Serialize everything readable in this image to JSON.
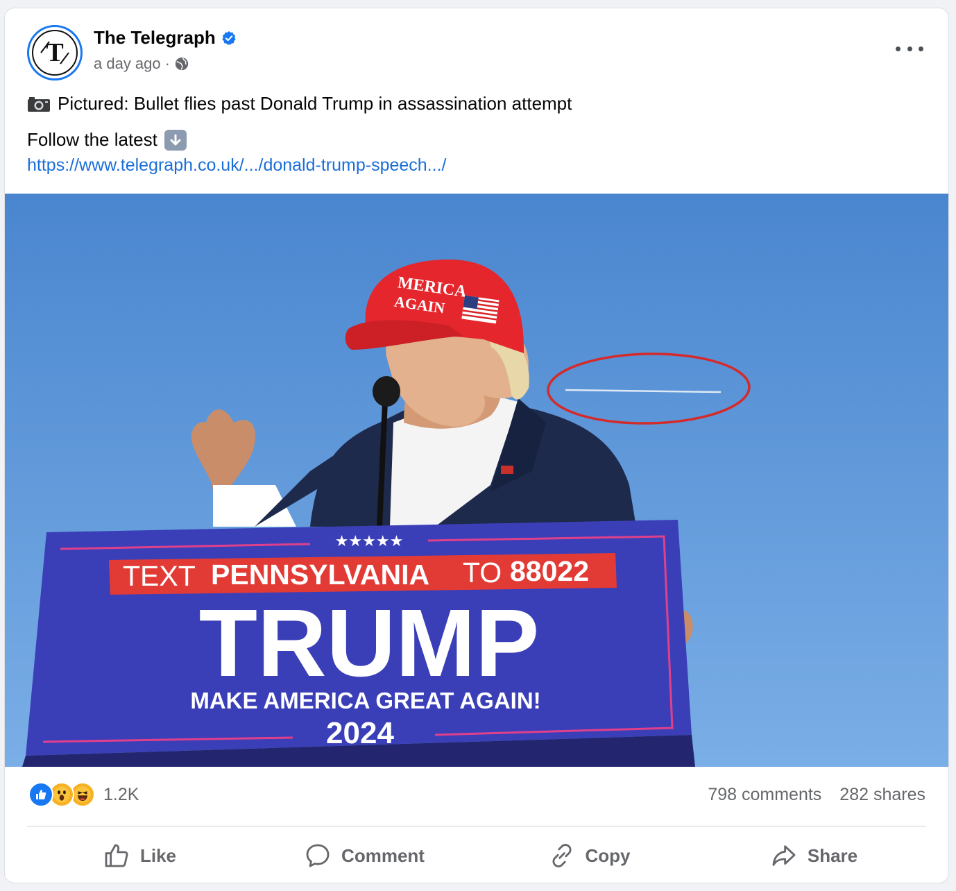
{
  "post": {
    "page_name": "The Telegraph",
    "timestamp": "a day ago",
    "separator": "·",
    "privacy_icon": "globe-icon",
    "verified_icon": "verified-badge-icon",
    "avatar_letter": "T",
    "caption_icon": "camera-icon",
    "caption": "Pictured: Bullet flies past Donald Trump in assassination attempt",
    "follow_text": "Follow the latest",
    "follow_icon": "down-arrow-icon",
    "link": "https://www.telegraph.co.uk/.../donald-trump-speech.../"
  },
  "photo": {
    "podium_line1_a": "TEXT",
    "podium_line1_b": "PENNSYLVANIA",
    "podium_line1_c": "TO",
    "podium_line1_d": "88022",
    "podium_name": "TRUMP",
    "podium_slogan": "MAKE AMERICA GREAT AGAIN!",
    "podium_year": "2024",
    "podium_stars": "★★★★★",
    "cap_text1": "MERICA",
    "cap_text2": "AGAIN"
  },
  "engagement": {
    "reactions": [
      "like-reaction-icon",
      "wow-reaction-icon",
      "haha-reaction-icon"
    ],
    "reaction_count": "1.2K",
    "comments": "798 comments",
    "shares": "282 shares"
  },
  "actions": {
    "like": "Like",
    "comment": "Comment",
    "copy": "Copy",
    "share": "Share"
  },
  "colors": {
    "brand_blue": "#1877f2",
    "link_blue": "#1a6ed8",
    "secondary_text": "#65676b",
    "sky": "#5b93d6",
    "podium_blue": "#3a3fb8",
    "podium_red": "#e23b36"
  }
}
